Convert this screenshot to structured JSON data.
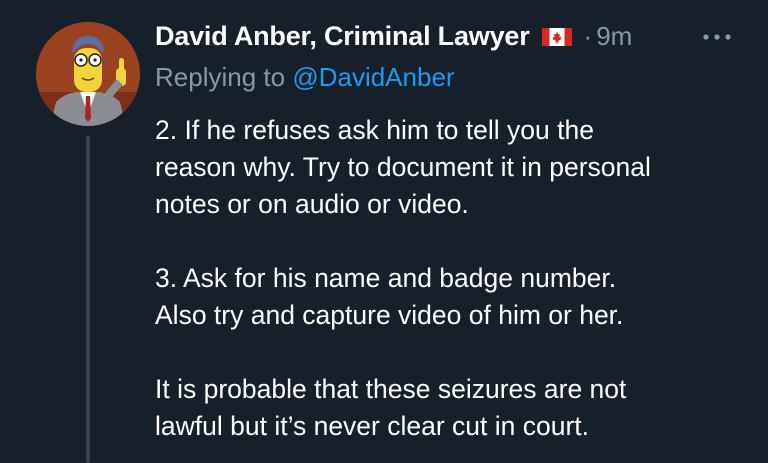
{
  "tweet": {
    "author": {
      "display_name": "David Anber, Criminal Lawyer",
      "flag": "canada-flag-icon"
    },
    "separator": "·",
    "time": "9m",
    "more_icon": "more-horizontal-icon",
    "replying_prefix": "Replying to",
    "replying_handle": "@DavidAnber",
    "paragraphs": [
      {
        "lines": [
          "2. If he refuses ask him to tell you the",
          "reason why. Try to document it in personal",
          "notes or on audio or video."
        ]
      },
      {
        "lines": [
          "3. Ask for his name and badge number.",
          "Also try and capture video of him or her."
        ]
      },
      {
        "lines": [
          "It is probable that these seizures are not",
          "lawful but it’s never clear cut in court."
        ]
      }
    ]
  },
  "colors": {
    "background": "#15202b",
    "text": "#ffffff",
    "secondary": "#8b98a5",
    "link": "#1d9bf0",
    "thread_line": "#38444d"
  }
}
